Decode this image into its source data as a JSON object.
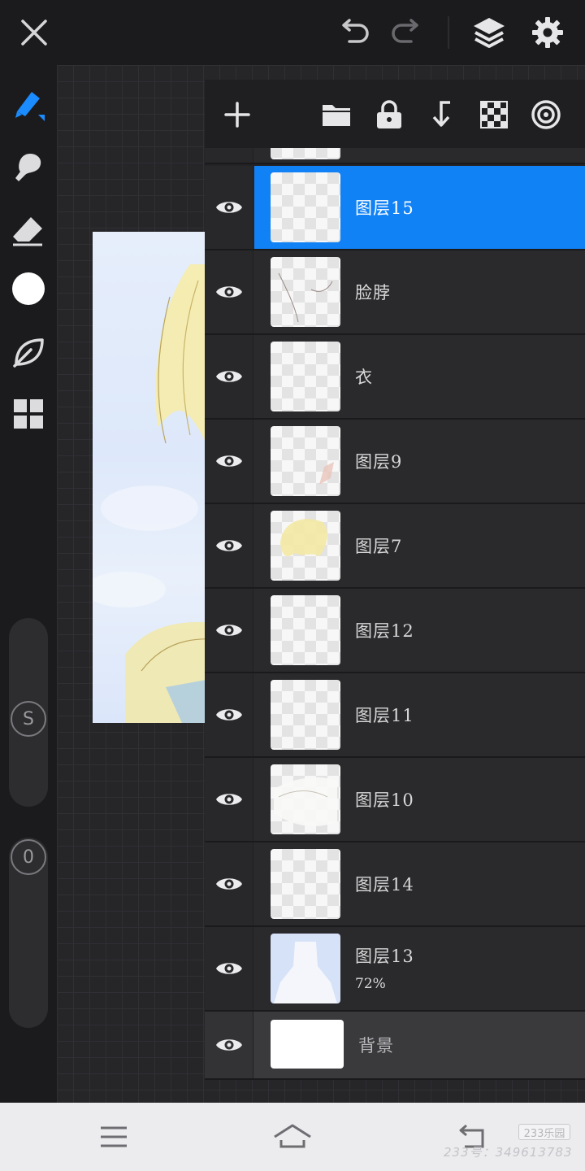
{
  "toolbar": {
    "close_icon": "close-icon",
    "undo_icon": "undo-icon",
    "redo_icon": "redo-icon",
    "layers_icon": "layers-icon",
    "settings_icon": "gear-icon"
  },
  "left_tools": {
    "items": [
      "brush-tool",
      "smudge-tool",
      "eraser-tool",
      "color-swatch",
      "leaf-tool",
      "grid-tool"
    ],
    "brush_size_label": "S",
    "opacity_label": "0"
  },
  "colors": {
    "accent": "#1182f5",
    "panel": "#2a2a2d"
  },
  "layers_panel": {
    "actions": [
      "add-layer",
      "folder",
      "lock",
      "merge-down",
      "transparency",
      "more"
    ],
    "layers": [
      {
        "name": "图层15",
        "selected": true,
        "visible": true
      },
      {
        "name": "脸脖",
        "visible": true
      },
      {
        "name": "衣",
        "visible": true
      },
      {
        "name": "图层9",
        "visible": true
      },
      {
        "name": "图层7",
        "visible": true
      },
      {
        "name": "图层12",
        "visible": true
      },
      {
        "name": "图层11",
        "visible": true
      },
      {
        "name": "图层10",
        "visible": true
      },
      {
        "name": "图层14",
        "visible": true
      },
      {
        "name": "图层13",
        "opacity": "72%",
        "visible": true
      },
      {
        "name": "背景",
        "visible": true,
        "background": true
      }
    ]
  },
  "navbar": {
    "menu_icon": "menu-icon",
    "home_icon": "home-icon",
    "back_icon": "back-icon"
  },
  "watermark": {
    "badge": "233乐园",
    "text": "233号：349613783"
  }
}
